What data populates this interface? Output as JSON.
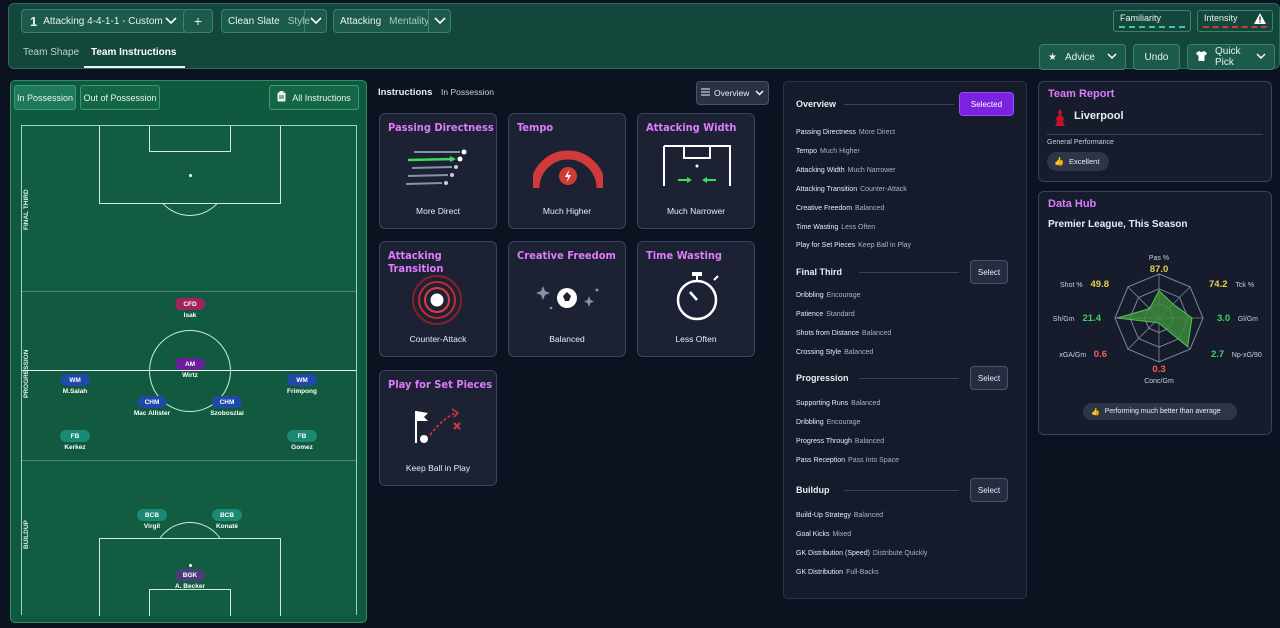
{
  "topbar": {
    "tactic_number": "1",
    "tactic_name": "Attacking 4-4-1-1 - Custom",
    "add_label": "+",
    "style_value": "Clean Slate",
    "style_label": "Style",
    "mentality_value": "Attacking",
    "mentality_label": "Mentality",
    "familiarity_label": "Familiarity",
    "intensity_label": "Intensity"
  },
  "subtabs": [
    "Team Shape",
    "Team Instructions"
  ],
  "actions": {
    "advice": "Advice",
    "undo": "Undo",
    "quick_pick": "Quick Pick"
  },
  "pitch": {
    "tabs": [
      "In Possession",
      "Out of Possession"
    ],
    "all_instructions": "All Instructions",
    "zones": [
      "FINAL THIRD",
      "PROGRESSION",
      "BUILDUP"
    ],
    "players": [
      {
        "pos": "CFD",
        "name": "Isak",
        "color": "#a0235f"
      },
      {
        "pos": "AM",
        "name": "Wirtz",
        "color": "#6a1f9c"
      },
      {
        "pos": "WM",
        "name": "M.Salah",
        "color": "#1f4aa8"
      },
      {
        "pos": "WM",
        "name": "Frimpong",
        "color": "#1f4aa8"
      },
      {
        "pos": "CHM",
        "name": "Mac Allister",
        "color": "#1f4aa8"
      },
      {
        "pos": "CHM",
        "name": "Szoboszlai",
        "color": "#1f4aa8"
      },
      {
        "pos": "FB",
        "name": "Kerkez",
        "color": "#1a8a74"
      },
      {
        "pos": "FB",
        "name": "Gomez",
        "color": "#1a8a74"
      },
      {
        "pos": "BCB",
        "name": "Virgil",
        "color": "#1a8a74"
      },
      {
        "pos": "BCB",
        "name": "Konaté",
        "color": "#1a8a74"
      },
      {
        "pos": "BGK",
        "name": "A. Becker",
        "color": "#4a3e7a"
      }
    ]
  },
  "instructions": {
    "heading": "Instructions",
    "context": "In Possession",
    "view": "Overview",
    "cards": [
      {
        "title": "Passing Directness",
        "value": "More Direct"
      },
      {
        "title": "Tempo",
        "value": "Much Higher"
      },
      {
        "title": "Attacking Width",
        "value": "Much Narrower"
      },
      {
        "title": "Attacking Transition",
        "value": "Counter-Attack"
      },
      {
        "title": "Creative Freedom",
        "value": "Balanced"
      },
      {
        "title": "Time Wasting",
        "value": "Less Often"
      },
      {
        "title": "Play for Set Pieces",
        "value": "Keep Ball in Play"
      }
    ]
  },
  "overview": {
    "sections": [
      {
        "title": "Overview",
        "button": "Selected",
        "rows": [
          [
            "Passing Directness",
            "More Direct"
          ],
          [
            "Tempo",
            "Much Higher"
          ],
          [
            "Attacking Width",
            "Much Narrower"
          ],
          [
            "Attacking Transition",
            "Counter-Attack"
          ],
          [
            "Creative Freedom",
            "Balanced"
          ],
          [
            "Time Wasting",
            "Less Often"
          ],
          [
            "Play for Set Pieces",
            "Keep Ball in Play"
          ]
        ]
      },
      {
        "title": "Final Third",
        "button": "Select",
        "rows": [
          [
            "Dribbling",
            "Encourage"
          ],
          [
            "Patience",
            "Standard"
          ],
          [
            "Shots from Distance",
            "Balanced"
          ],
          [
            "Crossing Style",
            "Balanced"
          ]
        ]
      },
      {
        "title": "Progression",
        "button": "Select",
        "rows": [
          [
            "Supporting Runs",
            "Balanced"
          ],
          [
            "Dribbling",
            "Encourage"
          ],
          [
            "Progress Through",
            "Balanced"
          ],
          [
            "Pass Reception",
            "Pass Into Space"
          ]
        ]
      },
      {
        "title": "Buildup",
        "button": "Select",
        "rows": [
          [
            "Build-Up Strategy",
            "Balanced"
          ],
          [
            "Goal Kicks",
            "Mixed"
          ],
          [
            "GK Distribution (Speed)",
            "Distribute Quickly"
          ],
          [
            "GK Distribution",
            "Full-Backs"
          ]
        ]
      }
    ]
  },
  "team_report": {
    "title": "Team Report",
    "team": "Liverpool",
    "perf_label": "General Performance",
    "perf_value": "Excellent"
  },
  "data_hub": {
    "title": "Data Hub",
    "subtitle": "Premier League, This Season",
    "footer": "Performing much better than average",
    "stats": [
      {
        "label": "Pas %",
        "value": "87.0",
        "color": "#e6d24a"
      },
      {
        "label": "Tck %",
        "value": "74.2",
        "color": "#e6d24a"
      },
      {
        "label": "Gl/Gm",
        "value": "3.0",
        "color": "#3fd26a"
      },
      {
        "label": "Np-xG/90",
        "value": "2.7",
        "color": "#3fd26a"
      },
      {
        "label": "Conc/Gm",
        "value": "0.3",
        "color": "#ff5a5a"
      },
      {
        "label": "xGA/Gm",
        "value": "0.6",
        "color": "#ff5a5a"
      },
      {
        "label": "Sh/Gm",
        "value": "21.4",
        "color": "#3fd26a"
      },
      {
        "label": "Shot %",
        "value": "49.8",
        "color": "#e6d24a"
      }
    ]
  }
}
